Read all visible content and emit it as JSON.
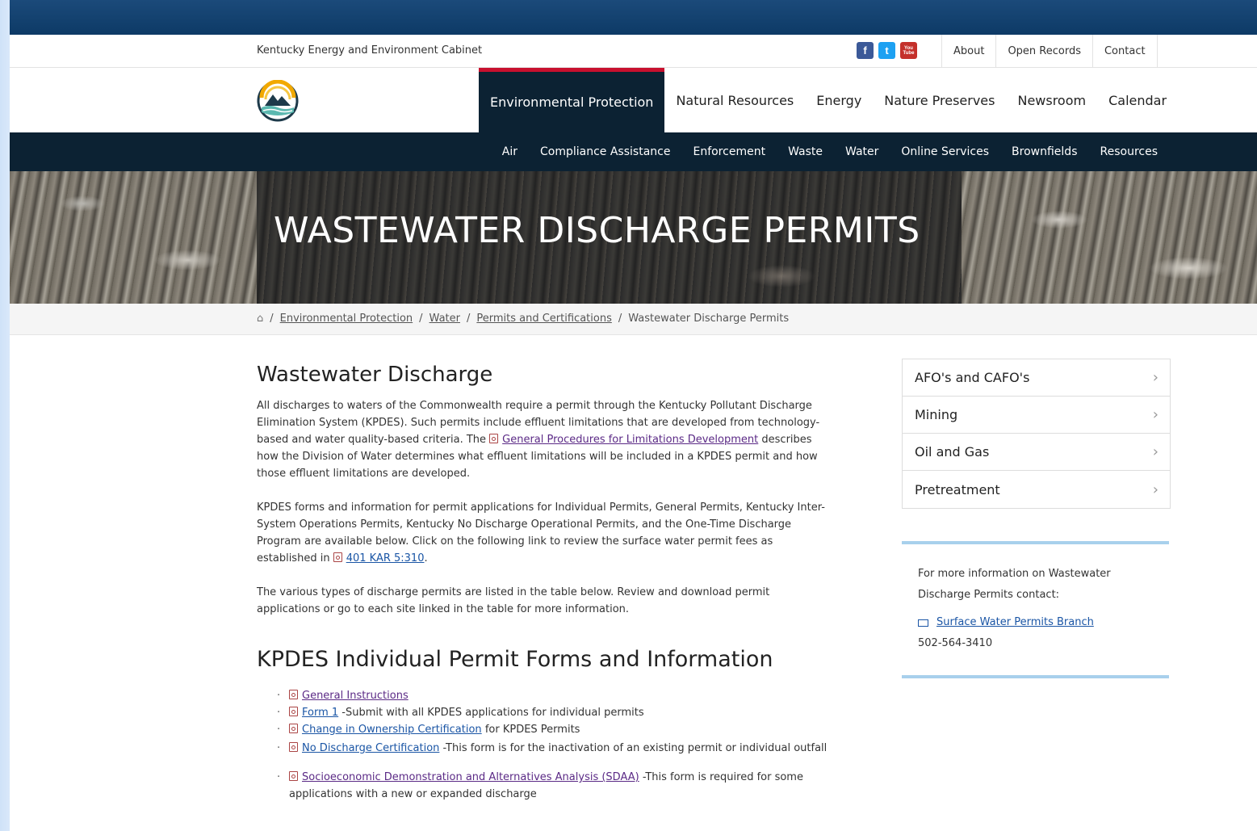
{
  "utility": {
    "agency": "Kentucky Energy and Environment Cabinet",
    "social": [
      {
        "icon": "facebook-icon",
        "glyph": "f",
        "color": "#3b5998"
      },
      {
        "icon": "twitter-icon",
        "glyph": "t",
        "color": "#1da1f2"
      },
      {
        "icon": "youtube-icon",
        "glyph": "You Tube",
        "color": "#c4302b"
      }
    ],
    "links": [
      "About",
      "Open Records",
      "Contact"
    ]
  },
  "mainnav": {
    "items": [
      "Environmental Protection",
      "Natural Resources",
      "Energy",
      "Nature Preserves",
      "Newsroom",
      "Calendar"
    ],
    "active": "Environmental Protection"
  },
  "subnav": {
    "items": [
      "Air",
      "Compliance Assistance",
      "Enforcement",
      "Waste",
      "Water",
      "Online Services",
      "Brownfields",
      "Resources"
    ]
  },
  "hero": {
    "title": "WASTEWATER DISCHARGE PERMITS"
  },
  "breadcrumb": {
    "links": [
      "Environmental Protection",
      "Water",
      "Permits and Certifications"
    ],
    "current": "Wastewater Discharge Permits"
  },
  "content": {
    "heading": "Wastewater Discharge",
    "p1_a": "All discharges to waters of the Commonwealth require a permit through the Kentucky Pollutant Discharge Elimination System (KPDES).  Such permits include effluent limitations that are developed from technology-based and water quality-based criteria.  The ",
    "p1_link": "General Procedures for Limitations Development",
    "p1_b": " describes how the Division of Water determines what effluent limitations will be included in a KPDES permit and how those effluent limitations are developed.",
    "p2_a": "KPDES forms and information for permit applications for Individual Permits, General Permits, Kentucky Inter-System Operations Permits, Kentucky No Discharge Operational Permits, and the One-Time Discharge Program are available below.  Click on the following link to review the surface water permit fees as established in ",
    "p2_link": "401 KAR 5:310",
    "p2_b": ".",
    "p3": "The various types of discharge permits are listed in the table below. Review and download permit applications or go to each site linked in the table for more information.",
    "heading2": "KPDES Individual Permit Forms and Information",
    "list": [
      {
        "link": "General Instructions",
        "text": ""
      },
      {
        "link": "Form 1",
        "text": " -Submit with all KPDES applications for individual permits"
      },
      {
        "link": "Change in Ownership Certification",
        "text": " for KPDES Permits"
      },
      {
        "link": "No Discharge Certification",
        "text": " -This form is for the inactivation of an existing permit or individual outfall"
      },
      {
        "link": "Socioeconomic Demonstration and Alternatives Analysis (SDAA)",
        "text": " -This form is required for some applications with a new or expanded discharge"
      }
    ]
  },
  "sidenav": {
    "items": [
      "AFO's and CAFO's",
      "Mining",
      "Oil and Gas",
      "Pretreatment"
    ]
  },
  "contact": {
    "intro": "For more information on Wastewater Discharge Permits contact:",
    "link": "Surface Water Permits Branch",
    "phone": "502-564-3410"
  }
}
